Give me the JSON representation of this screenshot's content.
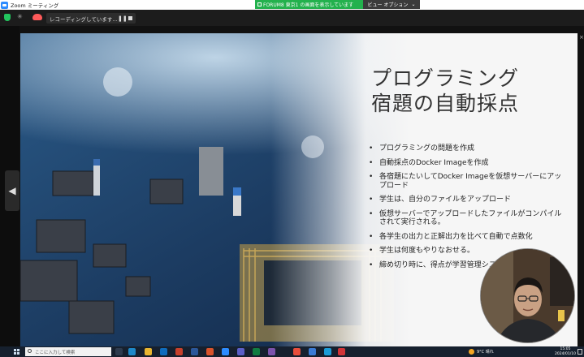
{
  "window": {
    "title": "Zoom ミーティング"
  },
  "share_banner": {
    "text": "FORUM8 東京1 の画面を表示しています"
  },
  "view_options": {
    "label": "ビュー オプション",
    "chevron": "chevron-down-icon"
  },
  "recording": {
    "status": "レコーディングしています..."
  },
  "slide": {
    "title_lines": [
      "プログラミング",
      "宿題の自動採点"
    ],
    "bullets": [
      "プログラミングの問題を作成",
      "自動採点のDocker Imageを作成",
      "各宿題にたいしてDocker Imageを仮想サーバーにアップロード",
      "学生は、自分のファイルをアップロード",
      "仮想サーバーでアップロードしたファイルがコンパイルされて実行される。",
      "各学生の出力と正解出力を比べて自動で点数化",
      "学生は何度もやりなおせる。",
      "締め切り時に、得点が学習管理システムに登録される。"
    ]
  },
  "taskbar": {
    "search_placeholder": "ここに入力して検索",
    "weather": "9°C 晴れ",
    "time": "15:05",
    "date": "2024/01/10"
  },
  "colors": {
    "share_green": "#23b14d",
    "zoom_blue": "#2d8cff",
    "record_red": "#ff5a5a",
    "taskbar": "#16202e"
  }
}
